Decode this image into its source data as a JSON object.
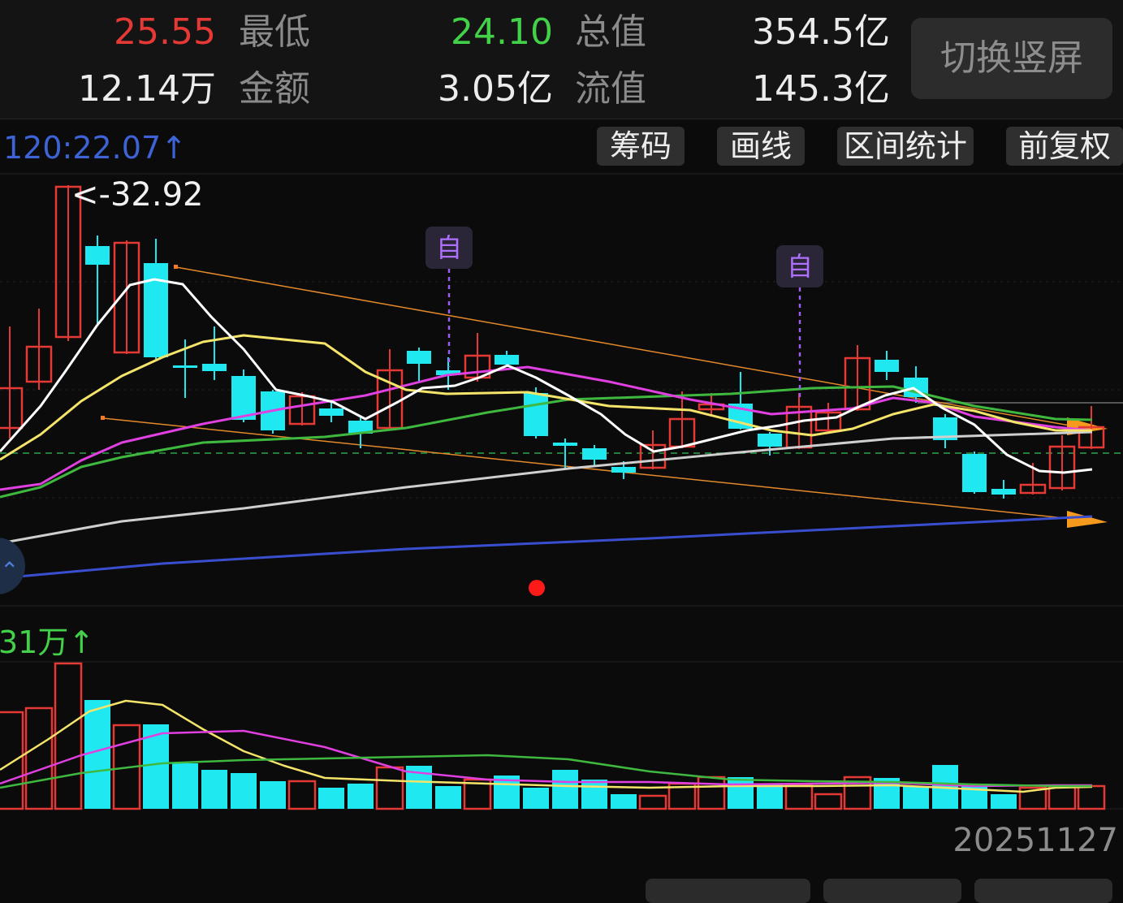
{
  "header": {
    "high_value": "25.55",
    "low_label": "最低",
    "low_value": "24.10",
    "total_cap_label": "总值",
    "total_cap_value": "354.5亿",
    "volume_value": "12.14万",
    "amount_label": "金额",
    "amount_value": "3.05亿",
    "float_cap_label": "流值",
    "float_cap_value": "145.3亿",
    "switch_label": "切换竖屏"
  },
  "ma_readout": "120:22.07↑",
  "toolbar": {
    "chips": "筹码",
    "draw_line": "画线",
    "interval_stats": "区间统计",
    "forward_adjust": "前复权"
  },
  "chart": {
    "max_annotation": "<-32.92",
    "markers": [
      "自",
      "自"
    ],
    "volume_readout": "31万↑",
    "date": "20251127"
  },
  "colors": {
    "up": "#e53935",
    "down": "#1fe8f0",
    "ma5": "#ffffff",
    "ma10": "#f5e46a",
    "ma20": "#e040e0",
    "ma30": "#3fb83f",
    "ma60": "#cfcfcf",
    "ma120": "#3a4fd0"
  }
}
